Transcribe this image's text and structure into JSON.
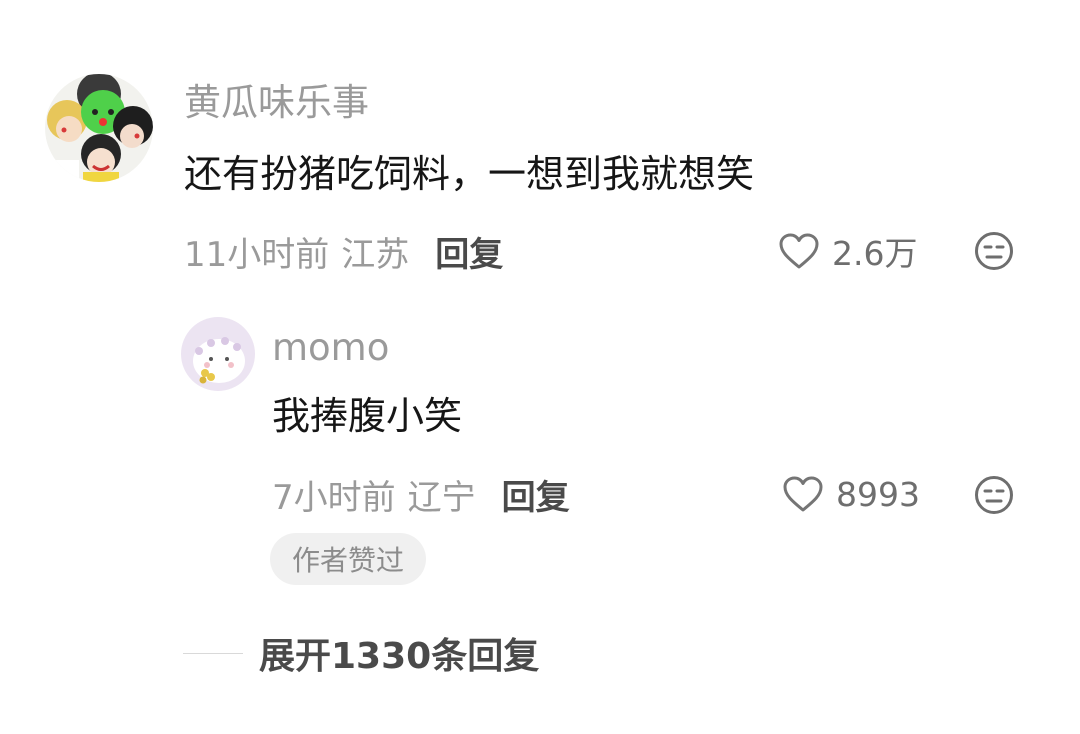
{
  "comment": {
    "username": "黄瓜味乐事",
    "text": "还有扮猪吃饲料，一想到我就想笑",
    "time": "11小时前",
    "location": "江苏",
    "reply_label": "回复",
    "like_count": "2.6万",
    "like_icon": "heart-outline-icon",
    "reaction_icon": "meh-face-icon"
  },
  "reply": {
    "username": "momo",
    "text": "我捧腹小笑",
    "time": "7小时前",
    "location": "辽宁",
    "reply_label": "回复",
    "like_count": "8993",
    "author_badge": "作者赞过",
    "like_icon": "heart-outline-icon",
    "reaction_icon": "meh-face-icon"
  },
  "expand_replies": {
    "label": "展开1330条回复"
  }
}
